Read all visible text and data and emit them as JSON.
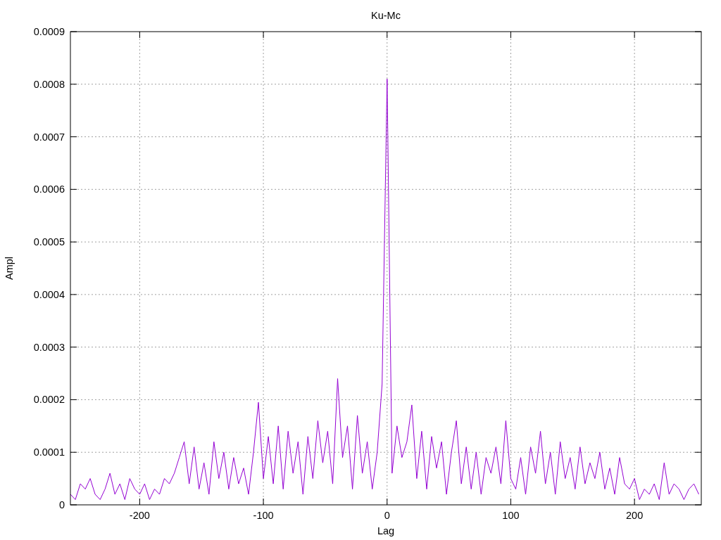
{
  "chart_data": {
    "type": "line",
    "title": "Ku-Mc",
    "xlabel": "Lag",
    "ylabel": "Ampl",
    "grid": true,
    "xlim": [
      -256,
      254
    ],
    "ylim": [
      0,
      0.0009
    ],
    "xticks": [
      -200,
      -100,
      0,
      100,
      200
    ],
    "yticks": [
      {
        "value": 0,
        "label": "0"
      },
      {
        "value": 0.0001,
        "label": "0.0001"
      },
      {
        "value": 0.0002,
        "label": "0.0002"
      },
      {
        "value": 0.0003,
        "label": "0.0003"
      },
      {
        "value": 0.0004,
        "label": "0.0004"
      },
      {
        "value": 0.0005,
        "label": "0.0005"
      },
      {
        "value": 0.0006,
        "label": "0.0006"
      },
      {
        "value": 0.0007,
        "label": "0.0007"
      },
      {
        "value": 0.0008,
        "label": "0.0008"
      },
      {
        "value": 0.0009,
        "label": "0.0009"
      }
    ],
    "x": [
      -256,
      -252,
      -248,
      -244,
      -240,
      -236,
      -232,
      -228,
      -224,
      -220,
      -216,
      -212,
      -208,
      -204,
      -200,
      -196,
      -192,
      -188,
      -184,
      -180,
      -176,
      -172,
      -168,
      -164,
      -160,
      -156,
      -152,
      -148,
      -144,
      -140,
      -136,
      -132,
      -128,
      -124,
      -120,
      -116,
      -112,
      -108,
      -104,
      -100,
      -96,
      -92,
      -88,
      -84,
      -80,
      -76,
      -72,
      -68,
      -64,
      -60,
      -56,
      -52,
      -48,
      -44,
      -40,
      -36,
      -32,
      -28,
      -24,
      -20,
      -16,
      -12,
      -8,
      -4,
      0,
      4,
      8,
      12,
      16,
      20,
      24,
      28,
      32,
      36,
      40,
      44,
      48,
      52,
      56,
      60,
      64,
      68,
      72,
      76,
      80,
      84,
      88,
      92,
      96,
      100,
      104,
      108,
      112,
      116,
      120,
      124,
      128,
      132,
      136,
      140,
      144,
      148,
      152,
      156,
      160,
      164,
      168,
      172,
      176,
      180,
      184,
      188,
      192,
      196,
      200,
      204,
      208,
      212,
      216,
      220,
      224,
      228,
      232,
      236,
      240,
      244,
      248,
      252
    ],
    "series": [
      {
        "color": "#9400d3",
        "values": [
          2e-05,
          1e-05,
          4e-05,
          3e-05,
          5e-05,
          2e-05,
          1e-05,
          3e-05,
          6e-05,
          2e-05,
          4e-05,
          1e-05,
          5e-05,
          3e-05,
          2e-05,
          4e-05,
          1e-05,
          3e-05,
          2e-05,
          5e-05,
          4e-05,
          6e-05,
          9e-05,
          0.00012,
          4e-05,
          0.00011,
          3e-05,
          8e-05,
          2e-05,
          0.00012,
          5e-05,
          0.0001,
          3e-05,
          9e-05,
          4e-05,
          7e-05,
          2e-05,
          0.0001,
          0.000195,
          5e-05,
          0.00013,
          4e-05,
          0.00015,
          3e-05,
          0.00014,
          6e-05,
          0.00012,
          2e-05,
          0.00013,
          5e-05,
          0.00016,
          8e-05,
          0.00014,
          4e-05,
          0.00024,
          9e-05,
          0.00015,
          3e-05,
          0.00017,
          6e-05,
          0.00012,
          3e-05,
          0.0001,
          0.00023,
          0.00081,
          6e-05,
          0.00015,
          9e-05,
          0.00012,
          0.00019,
          5e-05,
          0.00014,
          3e-05,
          0.00013,
          7e-05,
          0.00012,
          2e-05,
          0.0001,
          0.00016,
          4e-05,
          0.00011,
          3e-05,
          0.0001,
          2e-05,
          9e-05,
          6e-05,
          0.00011,
          4e-05,
          0.00016,
          5e-05,
          3e-05,
          9e-05,
          2e-05,
          0.00011,
          6e-05,
          0.00014,
          4e-05,
          0.0001,
          2e-05,
          0.00012,
          5e-05,
          9e-05,
          3e-05,
          0.00011,
          4e-05,
          8e-05,
          5e-05,
          0.0001,
          3e-05,
          7e-05,
          2e-05,
          9e-05,
          4e-05,
          3e-05,
          5e-05,
          1e-05,
          3e-05,
          2e-05,
          4e-05,
          1e-05,
          8e-05,
          2e-05,
          4e-05,
          3e-05,
          1e-05,
          3e-05,
          4e-05,
          2e-05
        ]
      }
    ]
  }
}
